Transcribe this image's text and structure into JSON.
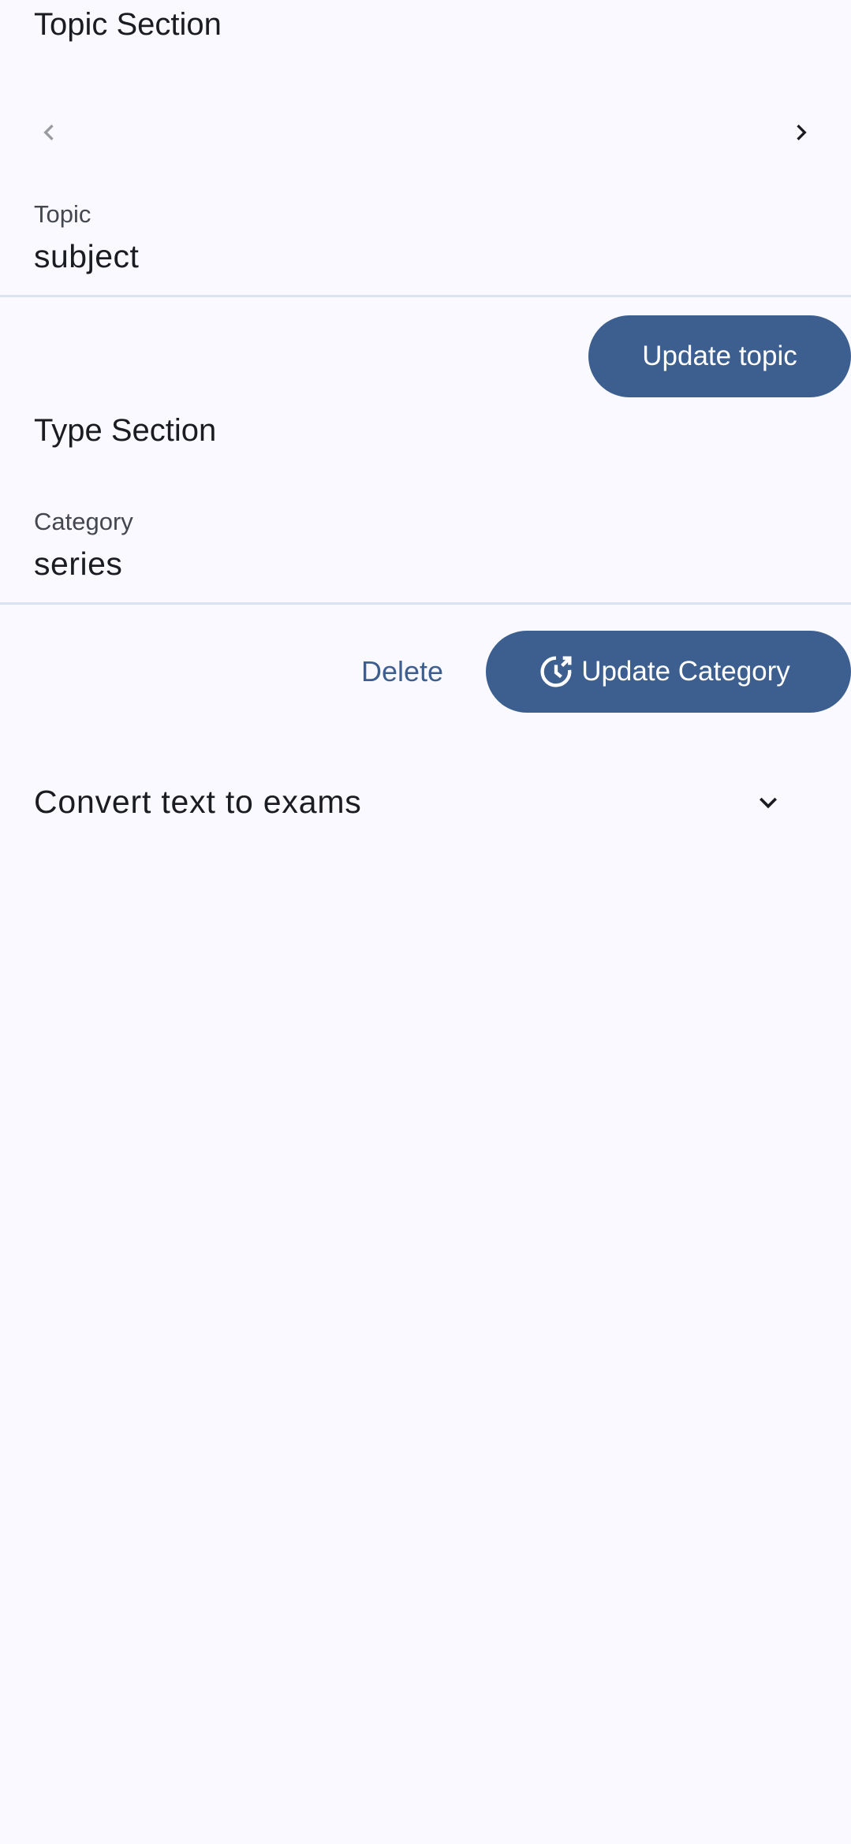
{
  "topic_section": {
    "title": "Topic Section",
    "field": {
      "label": "Topic",
      "value": "subject"
    },
    "update_button_label": "Update topic",
    "nav": {
      "prev_icon": "chevron-left-icon",
      "next_icon": "chevron-right-icon"
    }
  },
  "type_section": {
    "title": "Type Section",
    "field": {
      "label": "Category",
      "value": "series"
    },
    "delete_button_label": "Delete",
    "update_button_label": "Update Category",
    "update_button_icon": "update-icon"
  },
  "converter": {
    "label": "Convert text to exams",
    "icon": "chevron-down-icon"
  },
  "colors": {
    "background": "#F9F9FF",
    "primary": "#3D5F90",
    "on_primary": "#FFFFFF",
    "text": "#1A1C20",
    "text_secondary": "#44474E",
    "divider": "#DCE3F0",
    "disabled_icon": "#9A9BA0"
  }
}
